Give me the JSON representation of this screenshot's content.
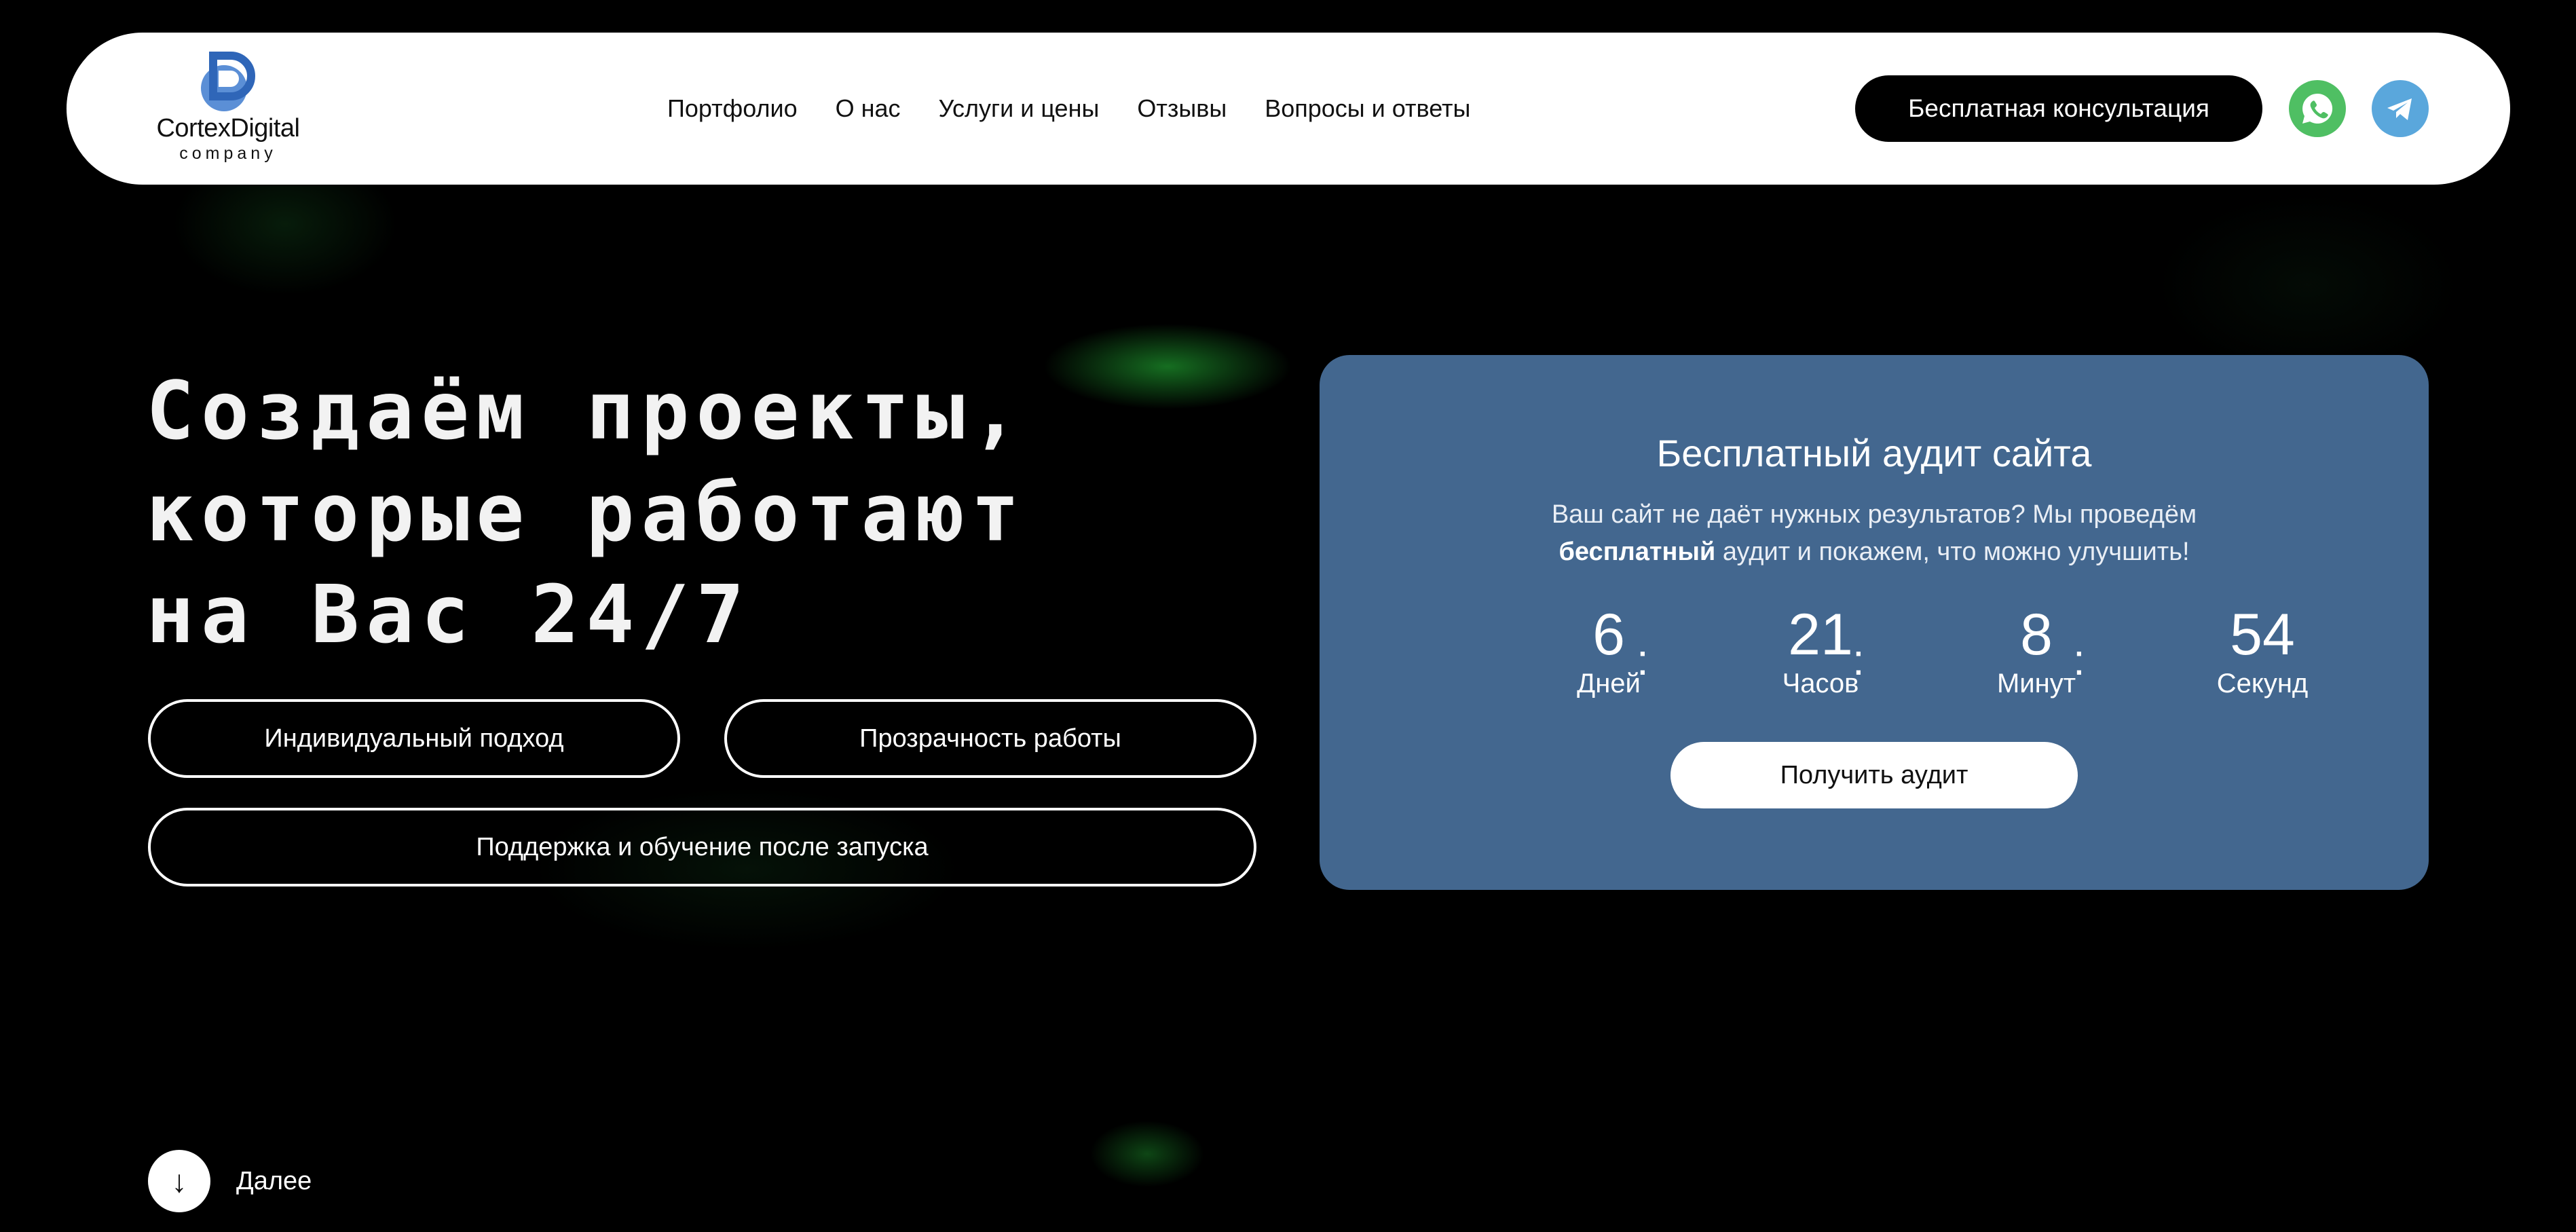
{
  "header": {
    "logo": {
      "name": "CortexDigital",
      "subtitle": "company"
    },
    "nav": [
      "Портфолио",
      "О нас",
      "Услуги и цены",
      "Отзывы",
      "Вопросы и ответы"
    ],
    "cta_label": "Бесплатная консультация",
    "social": [
      {
        "icon": "whatsapp-icon",
        "color": "#4fbf63"
      },
      {
        "icon": "telegram-icon",
        "color": "#5aa7dc"
      }
    ]
  },
  "hero": {
    "title_lines": [
      "Создаём проекты,",
      "которые работают",
      "на Вас 24/7"
    ],
    "features": [
      "Индивидуальный подход",
      "Прозрачность работы",
      "Поддержка и обучение после запуска"
    ]
  },
  "audit": {
    "title": "Бесплатный аудит сайта",
    "text_line1": "Ваш сайт не даёт нужных результатов? Мы проведём",
    "text_bold": "бесплатный",
    "text_line2_rest": " аудит и покажем, что можно улучшить!",
    "countdown": [
      {
        "value": "6",
        "label": "Дней"
      },
      {
        "value": "21",
        "label": "Часов"
      },
      {
        "value": "8",
        "label": "Минут"
      },
      {
        "value": "54",
        "label": "Секунд"
      }
    ],
    "separator": ":",
    "button_label": "Получить аудит",
    "card_color": "#43678f"
  },
  "scroll": {
    "arrow": "↓",
    "label": "Далее"
  }
}
